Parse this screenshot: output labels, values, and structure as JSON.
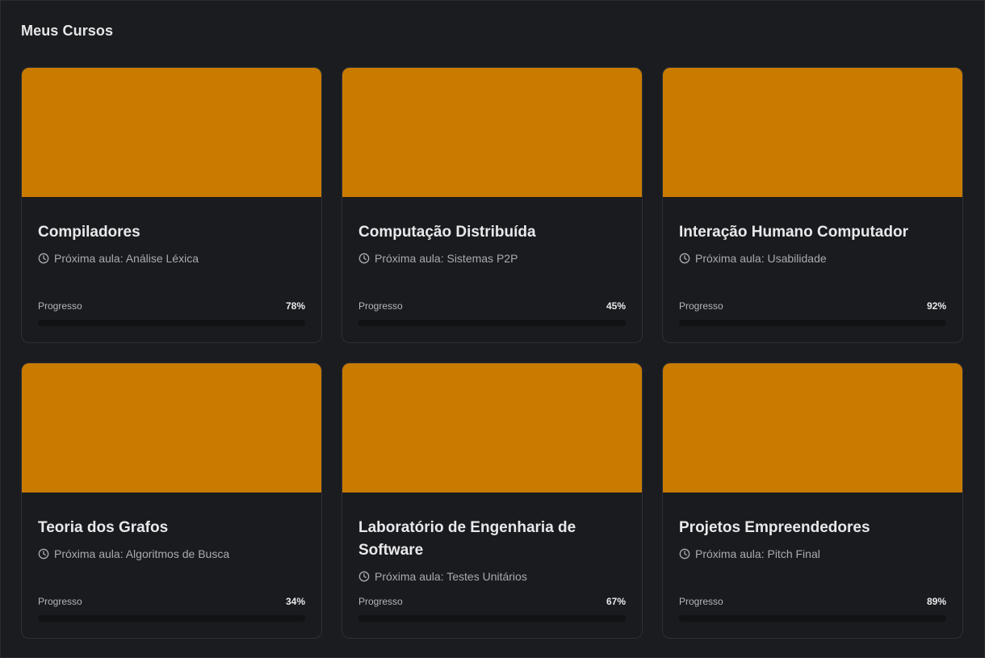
{
  "page": {
    "title": "Meus Cursos"
  },
  "colors": {
    "cover": "#c97b00",
    "background": "#1b1c1f",
    "card": "#1a1b1e"
  },
  "icons": {
    "next_lesson": "clock-icon"
  },
  "progress_label": "Progresso",
  "courses": [
    {
      "title": "Compiladores",
      "next_lesson": "Próxima aula: Análise Léxica",
      "progress_text": "78%",
      "progress": 78
    },
    {
      "title": "Computação Distribuída",
      "next_lesson": "Próxima aula: Sistemas P2P",
      "progress_text": "45%",
      "progress": 45
    },
    {
      "title": "Interação Humano Computador",
      "next_lesson": "Próxima aula: Usabilidade",
      "progress_text": "92%",
      "progress": 92
    },
    {
      "title": "Teoria dos Grafos",
      "next_lesson": "Próxima aula: Algoritmos de Busca",
      "progress_text": "34%",
      "progress": 34
    },
    {
      "title": "Laboratório de Engenharia de Software",
      "next_lesson": "Próxima aula: Testes Unitários",
      "progress_text": "67%",
      "progress": 67
    },
    {
      "title": "Projetos Empreendedores",
      "next_lesson": "Próxima aula: Pitch Final",
      "progress_text": "89%",
      "progress": 89
    }
  ]
}
